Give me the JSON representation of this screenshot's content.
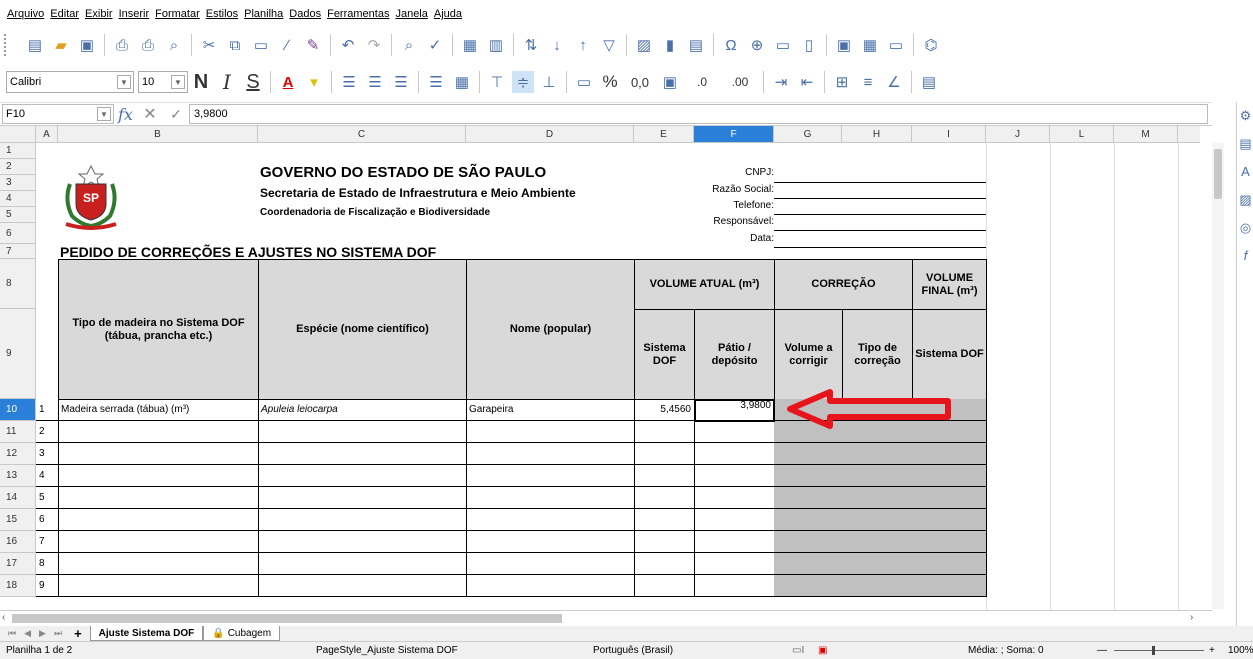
{
  "menu": [
    "Arquivo",
    "Editar",
    "Exibir",
    "Inserir",
    "Formatar",
    "Estilos",
    "Planilha",
    "Dados",
    "Ferramentas",
    "Janela",
    "Ajuda"
  ],
  "toolbar2": {
    "font": "Calibri",
    "size": "10",
    "bold": "N",
    "italic": "I",
    "underline": "S",
    "percent": "%",
    "decimals": "0,0"
  },
  "formula": {
    "cell_ref": "F10",
    "content": "3,9800"
  },
  "columns": [
    "A",
    "B",
    "C",
    "D",
    "E",
    "F",
    "G",
    "H",
    "I",
    "J",
    "L",
    "M"
  ],
  "selected_column": "F",
  "rows": [
    "1",
    "2",
    "3",
    "4",
    "5",
    "6",
    "7",
    "8",
    "9",
    "10",
    "11",
    "12",
    "13",
    "14",
    "15",
    "16",
    "17",
    "18"
  ],
  "header": {
    "gov": "GOVERNO DO ESTADO DE SÃO PAULO",
    "secretaria": "Secretaria de Estado de Infraestrutura e Meio Ambiente",
    "coord": "Coordenadoria de Fiscalização e Biodiversidade",
    "title": "PEDIDO DE CORREÇÕES E AJUSTES NO SISTEMA DOF",
    "info_labels": [
      "CNPJ:",
      "Razão Social:",
      "Telefone:",
      "Responsável:",
      "Data:"
    ]
  },
  "table_headers": {
    "tipo": "Tipo de madeira no Sistema DOF (tábua, prancha etc.)",
    "especie": "Espécie (nome científico)",
    "nome": "Nome (popular)",
    "volume_atual": "VOLUME ATUAL (m³)",
    "correcao": "CORREÇÃO",
    "volume_final": "VOLUME FINAL (m³)",
    "sistema_dof": "Sistema DOF",
    "patio": "Pátio / depósito",
    "vol_corrigir": "Volume a corrigir",
    "tipo_correcao": "Tipo de correção",
    "sistema_dof2": "Sistema DOF"
  },
  "data_rows": [
    {
      "n": "1",
      "tipo": "Madeira serrada (tábua) (m³)",
      "especie": "Apuleia leiocarpa",
      "nome": "Garapeira",
      "sistema": "5,4560",
      "patio": "3,9800"
    },
    {
      "n": "2"
    },
    {
      "n": "3"
    },
    {
      "n": "4"
    },
    {
      "n": "5"
    },
    {
      "n": "6"
    },
    {
      "n": "7"
    },
    {
      "n": "8"
    },
    {
      "n": "9"
    }
  ],
  "tabs": [
    "Ajuste Sistema DOF",
    "Cubagem"
  ],
  "status": {
    "sheet": "Planilha 1 de 2",
    "style": "PageStyle_Ajuste Sistema DOF",
    "lang": "Português (Brasil)",
    "sum": "Média: ; Soma: 0",
    "zoom": "100%"
  },
  "accent": "#2a7fd8",
  "arrow_color": "#e8141c"
}
